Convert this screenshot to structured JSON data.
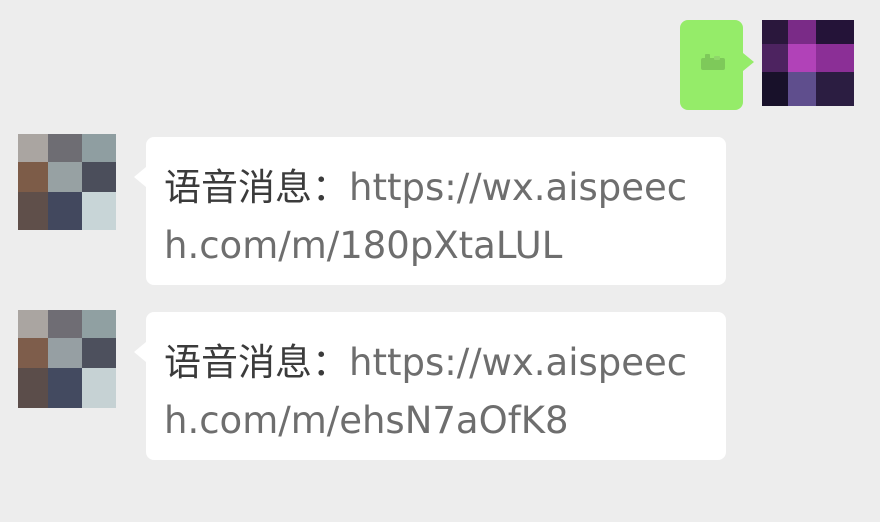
{
  "chat": {
    "outgoing": [
      {
        "type": "voice"
      }
    ],
    "incoming": [
      {
        "prefix": "语音消息：",
        "link": "https://wx.aispeech.com/m/180pXtaLUL"
      },
      {
        "prefix": "语音消息：",
        "link": "https://wx.aispeech.com/m/ehsN7aOfK8"
      }
    ]
  },
  "colors": {
    "background": "#ededed",
    "incoming_bubble": "#ffffff",
    "outgoing_bubble": "#95ec69",
    "text": "#757575"
  },
  "icons": {
    "outgoing_content": "voice-message-icon",
    "avatars": "blurred-avatar"
  }
}
